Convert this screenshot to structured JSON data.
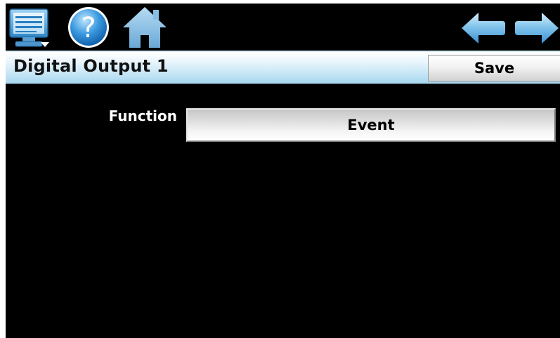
{
  "toolbar": {
    "icons": [
      "monitor-menu-icon",
      "help-icon",
      "home-icon",
      "back-arrow-icon",
      "forward-arrow-icon"
    ],
    "help_glyph": "?"
  },
  "header": {
    "title": "Digital Output 1",
    "save_label": "Save"
  },
  "form": {
    "function_label": "Function",
    "function_value": "Event"
  },
  "colors": {
    "background": "#000000",
    "header_gradient_top": "#ffffff",
    "header_gradient_bottom": "#a6d6ef",
    "icon_blue": "#4aa3dc"
  }
}
